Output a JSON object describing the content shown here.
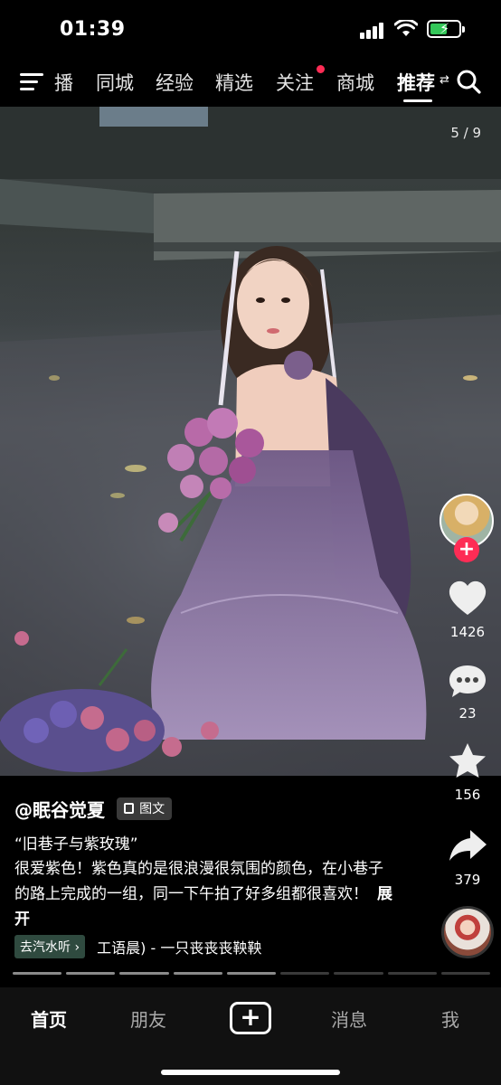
{
  "status_bar": {
    "time": "01:39",
    "battery_color": "#34c759"
  },
  "top_nav": {
    "tabs": [
      {
        "label": "播"
      },
      {
        "label": "同城"
      },
      {
        "label": "经验"
      },
      {
        "label": "精选"
      },
      {
        "label": "关注",
        "has_dot": true
      },
      {
        "label": "商城"
      },
      {
        "label": "推荐",
        "active": true
      }
    ],
    "dot_color": "#fe2c55",
    "active_arrows": "⇄"
  },
  "post": {
    "page_counter": "5 / 9",
    "author": "@眠谷觉夏",
    "tag": "图文",
    "title": "“旧巷子与紫玫瑰”",
    "body": "很爱紫色！紫色真的是很浪漫很氛围的颜色，在小巷子的路上完成的一组，同一下午拍了好多组都很喜欢！",
    "expand_label": "展开",
    "music_badge": "去汽水听 ›",
    "music_text": "工语晨) - 一只丧丧丧鞅鞅",
    "images_total": 9,
    "images_viewed": 5
  },
  "actions": {
    "follow_label": "+",
    "like_count": "1426",
    "comment_count": "23",
    "favorite_count": "156",
    "share_count": "379"
  },
  "bottom_nav": {
    "home": "首页",
    "friends": "朋友",
    "create": "+",
    "messages": "消息",
    "me": "我"
  },
  "colors": {
    "accent": "#fe2c55",
    "background": "#000000"
  }
}
